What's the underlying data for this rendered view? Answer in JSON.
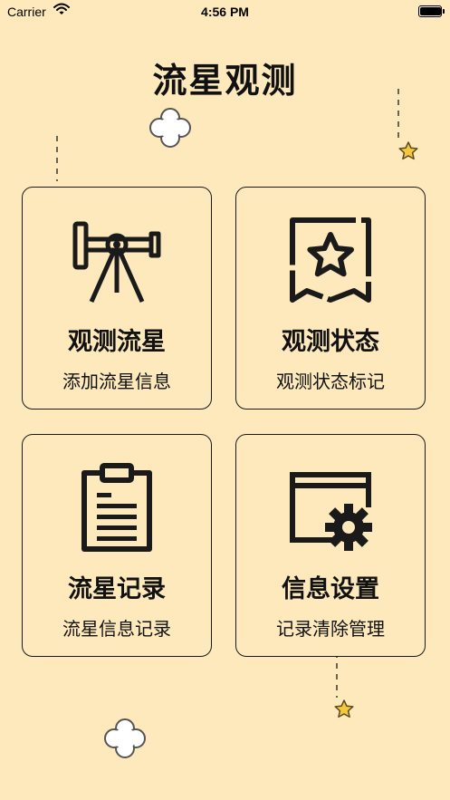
{
  "status_bar": {
    "carrier": "Carrier",
    "time": "4:56 PM",
    "battery_level": 0.95
  },
  "page": {
    "title": "流星观测"
  },
  "cards": [
    {
      "title": "观测流星",
      "subtitle": "添加流星信息",
      "icon": "telescope-icon"
    },
    {
      "title": "观测状态",
      "subtitle": "观测状态标记",
      "icon": "star-badge-icon"
    },
    {
      "title": "流星记录",
      "subtitle": "流星信息记录",
      "icon": "clipboard-icon"
    },
    {
      "title": "信息设置",
      "subtitle": "记录清除管理",
      "icon": "window-gear-icon"
    }
  ],
  "colors": {
    "background": "#FDE9BC",
    "ink": "#1a1a1a",
    "star": "#F3C83D",
    "cloud": "#FFFFFF"
  }
}
